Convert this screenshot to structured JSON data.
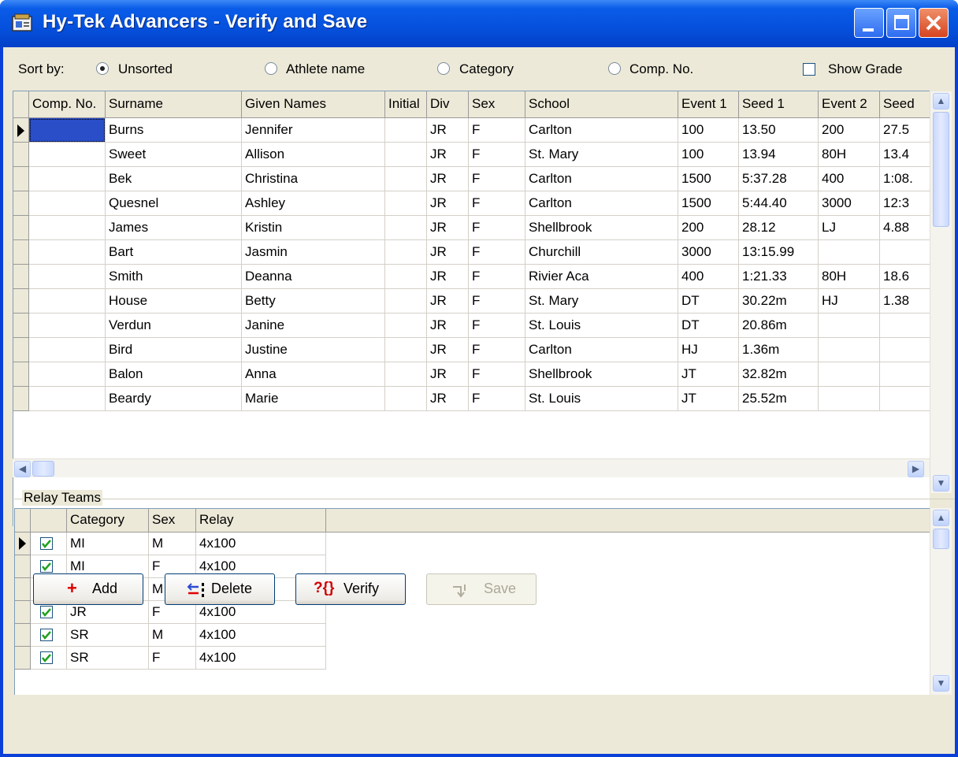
{
  "window": {
    "title": "Hy-Tek Advancers - Verify and Save"
  },
  "sort": {
    "label": "Sort by:",
    "options": [
      "Unsorted",
      "Athlete name",
      "Category",
      "Comp. No."
    ],
    "selected": "Unsorted",
    "show_grade_label": "Show Grade",
    "show_grade_checked": false
  },
  "athletes": {
    "columns": [
      "Comp. No.",
      "Surname",
      "Given Names",
      "Initial",
      "Div",
      "Sex",
      "School",
      "Event 1",
      "Seed 1",
      "Event 2",
      "Seed"
    ],
    "rows": [
      [
        "",
        "Burns",
        "Jennifer",
        "",
        "JR",
        "F",
        "Carlton",
        "100",
        "13.50",
        "200",
        "27.5"
      ],
      [
        "",
        "Sweet",
        "Allison",
        "",
        "JR",
        "F",
        "St. Mary",
        "100",
        "13.94",
        "80H",
        "13.4"
      ],
      [
        "",
        "Bek",
        "Christina",
        "",
        "JR",
        "F",
        "Carlton",
        "1500",
        "5:37.28",
        "400",
        "1:08."
      ],
      [
        "",
        "Quesnel",
        "Ashley",
        "",
        "JR",
        "F",
        "Carlton",
        "1500",
        "5:44.40",
        "3000",
        "12:3"
      ],
      [
        "",
        "James",
        "Kristin",
        "",
        "JR",
        "F",
        "Shellbrook",
        "200",
        "28.12",
        "LJ",
        "4.88"
      ],
      [
        "",
        "Bart",
        "Jasmin",
        "",
        "JR",
        "F",
        "Churchill",
        "3000",
        "13:15.99",
        "",
        ""
      ],
      [
        "",
        "Smith",
        "Deanna",
        "",
        "JR",
        "F",
        "Rivier Aca",
        "400",
        "1:21.33",
        "80H",
        "18.6"
      ],
      [
        "",
        "House",
        "Betty",
        "",
        "JR",
        "F",
        "St. Mary",
        "DT",
        "30.22m",
        "HJ",
        "1.38"
      ],
      [
        "",
        "Verdun",
        "Janine",
        "",
        "JR",
        "F",
        "St. Louis",
        "DT",
        "20.86m",
        "",
        ""
      ],
      [
        "",
        "Bird",
        "Justine",
        "",
        "JR",
        "F",
        "Carlton",
        "HJ",
        "1.36m",
        "",
        ""
      ],
      [
        "",
        "Balon",
        "Anna",
        "",
        "JR",
        "F",
        "Shellbrook",
        "JT",
        "32.82m",
        "",
        ""
      ],
      [
        "",
        "Beardy",
        "Marie",
        "",
        "JR",
        "F",
        "St. Louis",
        "JT",
        "25.52m",
        "",
        ""
      ]
    ]
  },
  "relay": {
    "group_label": "Relay Teams",
    "columns": [
      "Category",
      "Sex",
      "Relay"
    ],
    "rows": [
      {
        "checked": true,
        "category": "MI",
        "sex": "M",
        "relay": "4x100"
      },
      {
        "checked": true,
        "category": "MI",
        "sex": "F",
        "relay": "4x100"
      },
      {
        "checked": true,
        "category": "JR",
        "sex": "M",
        "relay": "4x100"
      },
      {
        "checked": true,
        "category": "JR",
        "sex": "F",
        "relay": "4x100"
      },
      {
        "checked": true,
        "category": "SR",
        "sex": "M",
        "relay": "4x100"
      },
      {
        "checked": true,
        "category": "SR",
        "sex": "F",
        "relay": "4x100"
      }
    ]
  },
  "buttons": {
    "add": {
      "label": "Add",
      "icon": "+"
    },
    "delete": {
      "label": "Delete",
      "icon": "delete-icon"
    },
    "verify": {
      "label": "Verify",
      "icon": "?{}"
    },
    "save": {
      "label": "Save",
      "icon": "save-icon",
      "enabled": false
    }
  },
  "colors": {
    "titlebar": "#0550dc",
    "face": "#ece9d8",
    "checkmark": "#21a121",
    "add_icon": "#e00000"
  }
}
